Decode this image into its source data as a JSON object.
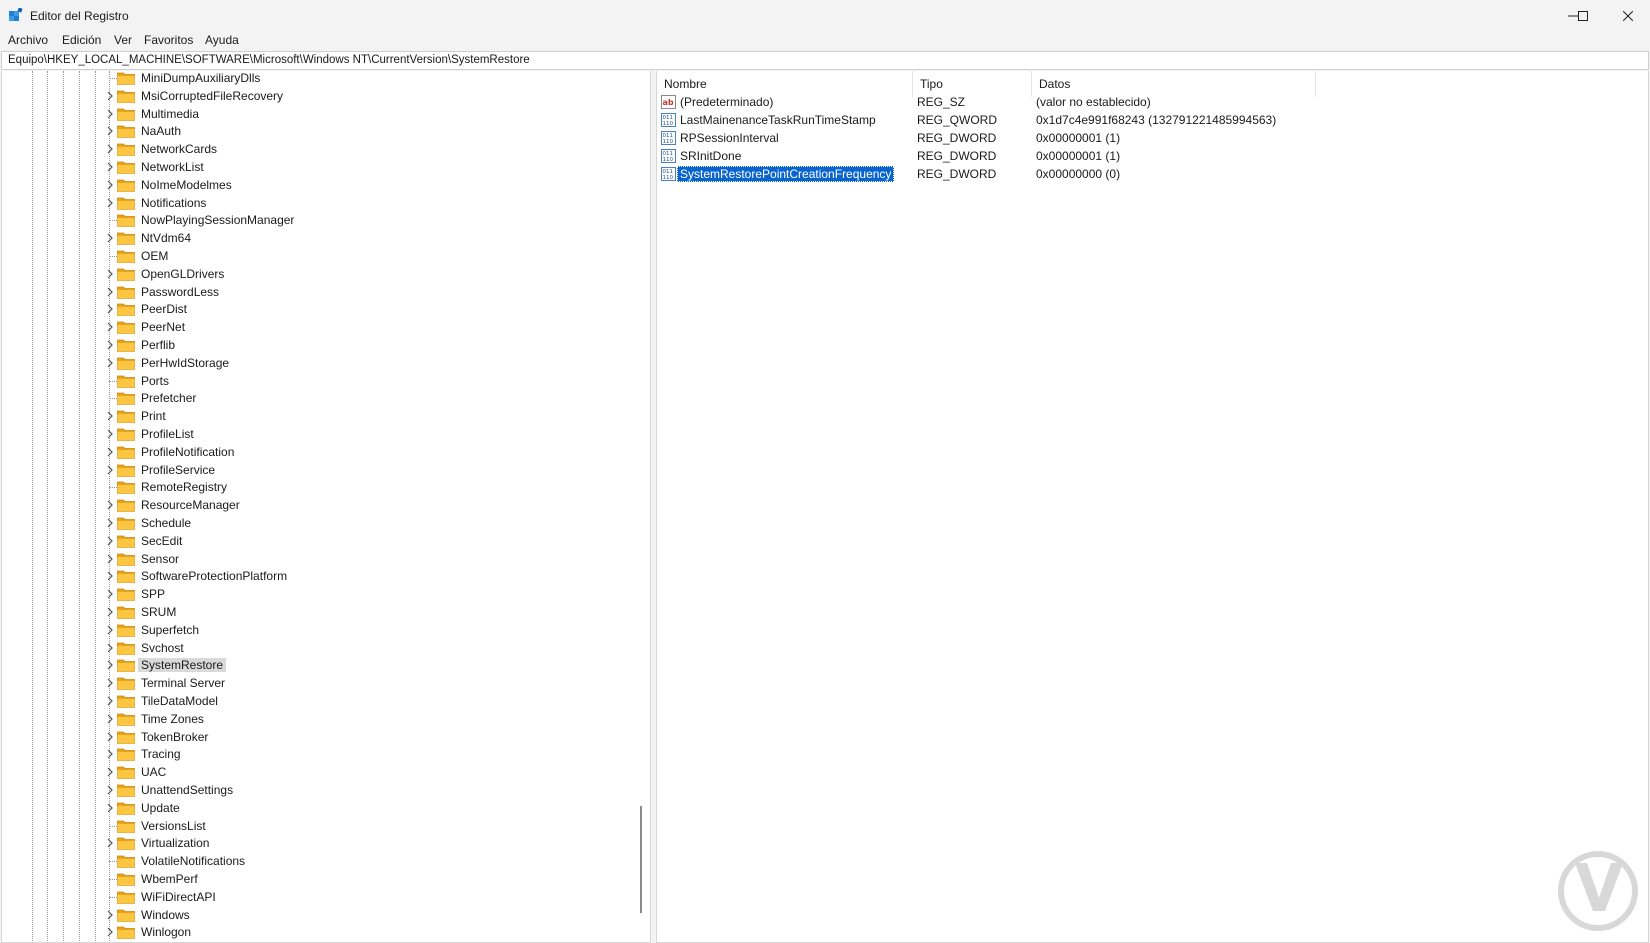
{
  "window": {
    "title": "Editor del Registro",
    "accent_color": "#0a64d0"
  },
  "menu": {
    "items": [
      "Archivo",
      "Edición",
      "Ver",
      "Favoritos",
      "Ayuda"
    ]
  },
  "address": {
    "path": "Equipo\\HKEY_LOCAL_MACHINE\\SOFTWARE\\Microsoft\\Windows NT\\CurrentVersion\\SystemRestore"
  },
  "tree": {
    "items": [
      {
        "label": "MiniDumpAuxiliaryDlls",
        "expandable": false
      },
      {
        "label": "MsiCorruptedFileRecovery",
        "expandable": true
      },
      {
        "label": "Multimedia",
        "expandable": true
      },
      {
        "label": "NaAuth",
        "expandable": true
      },
      {
        "label": "NetworkCards",
        "expandable": true
      },
      {
        "label": "NetworkList",
        "expandable": true
      },
      {
        "label": "NoImeModelmes",
        "expandable": true
      },
      {
        "label": "Notifications",
        "expandable": true
      },
      {
        "label": "NowPlayingSessionManager",
        "expandable": false
      },
      {
        "label": "NtVdm64",
        "expandable": true
      },
      {
        "label": "OEM",
        "expandable": false
      },
      {
        "label": "OpenGLDrivers",
        "expandable": true
      },
      {
        "label": "PasswordLess",
        "expandable": true
      },
      {
        "label": "PeerDist",
        "expandable": true
      },
      {
        "label": "PeerNet",
        "expandable": true
      },
      {
        "label": "Perflib",
        "expandable": true
      },
      {
        "label": "PerHwIdStorage",
        "expandable": true
      },
      {
        "label": "Ports",
        "expandable": false
      },
      {
        "label": "Prefetcher",
        "expandable": false
      },
      {
        "label": "Print",
        "expandable": true
      },
      {
        "label": "ProfileList",
        "expandable": true
      },
      {
        "label": "ProfileNotification",
        "expandable": true
      },
      {
        "label": "ProfileService",
        "expandable": true
      },
      {
        "label": "RemoteRegistry",
        "expandable": false
      },
      {
        "label": "ResourceManager",
        "expandable": true
      },
      {
        "label": "Schedule",
        "expandable": true
      },
      {
        "label": "SecEdit",
        "expandable": true
      },
      {
        "label": "Sensor",
        "expandable": true
      },
      {
        "label": "SoftwareProtectionPlatform",
        "expandable": true
      },
      {
        "label": "SPP",
        "expandable": true
      },
      {
        "label": "SRUM",
        "expandable": true
      },
      {
        "label": "Superfetch",
        "expandable": true
      },
      {
        "label": "Svchost",
        "expandable": true
      },
      {
        "label": "SystemRestore",
        "expandable": true,
        "selected": true
      },
      {
        "label": "Terminal Server",
        "expandable": true
      },
      {
        "label": "TileDataModel",
        "expandable": true
      },
      {
        "label": "Time Zones",
        "expandable": true
      },
      {
        "label": "TokenBroker",
        "expandable": true
      },
      {
        "label": "Tracing",
        "expandable": true
      },
      {
        "label": "UAC",
        "expandable": true
      },
      {
        "label": "UnattendSettings",
        "expandable": true
      },
      {
        "label": "Update",
        "expandable": true
      },
      {
        "label": "VersionsList",
        "expandable": false
      },
      {
        "label": "Virtualization",
        "expandable": true
      },
      {
        "label": "VolatileNotifications",
        "expandable": false
      },
      {
        "label": "WbemPerf",
        "expandable": false
      },
      {
        "label": "WiFiDirectAPI",
        "expandable": false
      },
      {
        "label": "Windows",
        "expandable": true
      },
      {
        "label": "Winlogon",
        "expandable": true
      }
    ]
  },
  "values": {
    "columns": [
      "Nombre",
      "Tipo",
      "Datos"
    ],
    "rows": [
      {
        "name": "(Predeterminado)",
        "type": "REG_SZ",
        "data": "(valor no establecido)",
        "icon": "string-value-icon"
      },
      {
        "name": "LastMainenanceTaskRunTimeStamp",
        "type": "REG_QWORD",
        "data": "0x1d7c4e991f68243 (132791221485994563)",
        "icon": "binary-value-icon"
      },
      {
        "name": "RPSessionInterval",
        "type": "REG_DWORD",
        "data": "0x00000001 (1)",
        "icon": "binary-value-icon"
      },
      {
        "name": "SRInitDone",
        "type": "REG_DWORD",
        "data": "0x00000001 (1)",
        "icon": "binary-value-icon"
      },
      {
        "name": "SystemRestorePointCreationFrequency",
        "type": "REG_DWORD",
        "data": "0x00000000 (0)",
        "icon": "binary-value-icon",
        "selected": true
      }
    ]
  }
}
